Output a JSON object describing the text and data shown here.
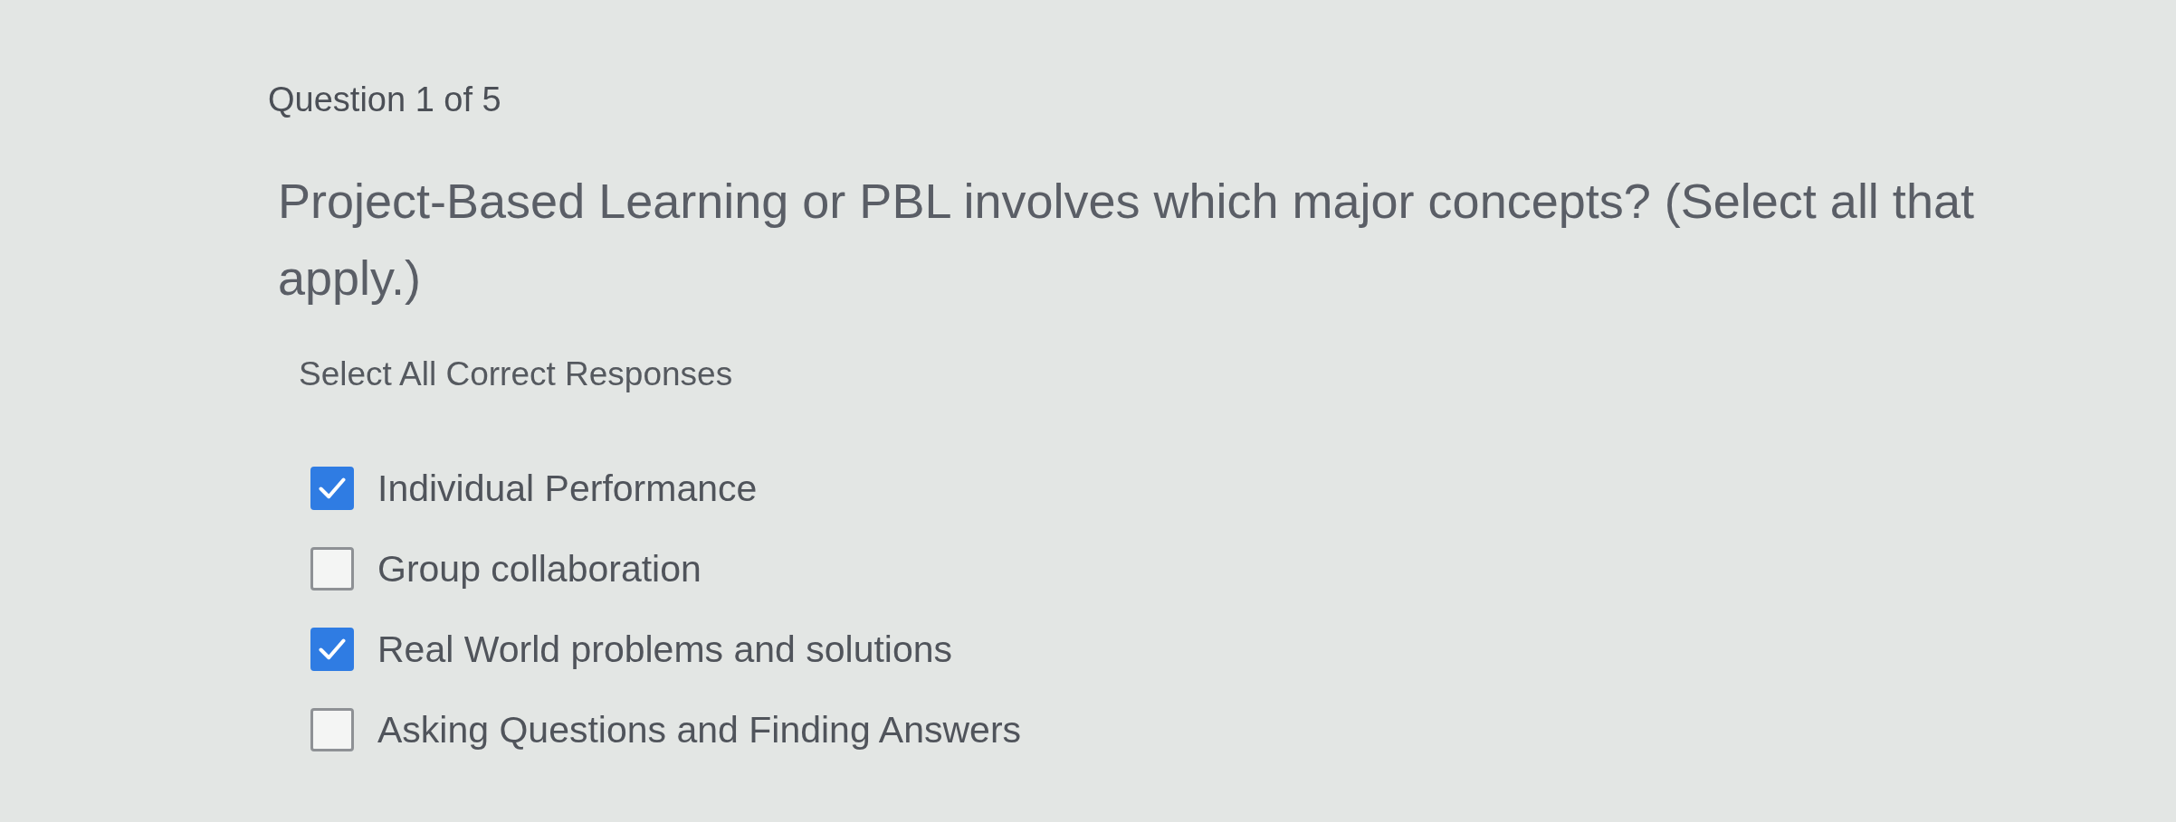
{
  "question": {
    "counter": "Question 1 of 5",
    "prompt": "Project-Based Learning or PBL involves which major concepts? (Select all that apply.)",
    "instruction": "Select All Correct Responses",
    "options": [
      {
        "label": "Individual Performance",
        "checked": true
      },
      {
        "label": "Group collaboration",
        "checked": false
      },
      {
        "label": "Real World problems and solutions",
        "checked": true
      },
      {
        "label": "Asking Questions and Finding Answers",
        "checked": false
      }
    ]
  }
}
